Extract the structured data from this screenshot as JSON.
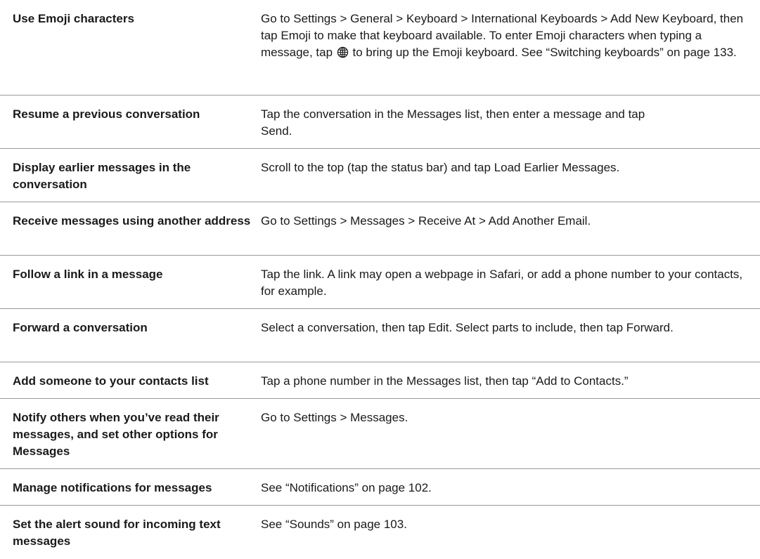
{
  "rows": [
    {
      "task": "Use Emoji characters",
      "desc_pre": "Go to Settings > General > Keyboard > International Keyboards > Add New Keyboard, then tap Emoji to make that keyboard available. To enter Emoji characters when typing a message, tap",
      "desc_icon": "globe-icon",
      "desc_post": "to bring up the Emoji keyboard. See “Switching keyboards” on page 133."
    },
    {
      "task": "Resume a previous conversation",
      "desc": "Tap the conversation in the Messages list, then enter a message and tap Send."
    },
    {
      "task": "Display earlier messages in the conversation",
      "desc": "Scroll to the top (tap the status bar) and tap Load Earlier Messages."
    },
    {
      "task": "Receive messages using another address",
      "desc": "Go to Settings > Messages > Receive At > Add Another Email."
    },
    {
      "task": "Follow a link in a message",
      "desc": "Tap the link. A link may open a webpage in Safari, or add a phone number to your contacts, for example."
    },
    {
      "task": "Forward a conversation",
      "desc": "Select a conversation, then tap Edit. Select parts to include, then tap Forward."
    },
    {
      "task": "Add someone to your contacts list",
      "desc": "Tap a phone number in the Messages list, then tap “Add to Contacts.”"
    },
    {
      "task": "Notify others when you’ve read their messages, and set other options for Messages",
      "desc": "Go to Settings > Messages."
    },
    {
      "task": "Manage notifications for messages",
      "desc": "See “Notifications” on page 102."
    },
    {
      "task": "Set the alert sound for incoming text messages",
      "desc": "See “Sounds” on page 103."
    }
  ]
}
